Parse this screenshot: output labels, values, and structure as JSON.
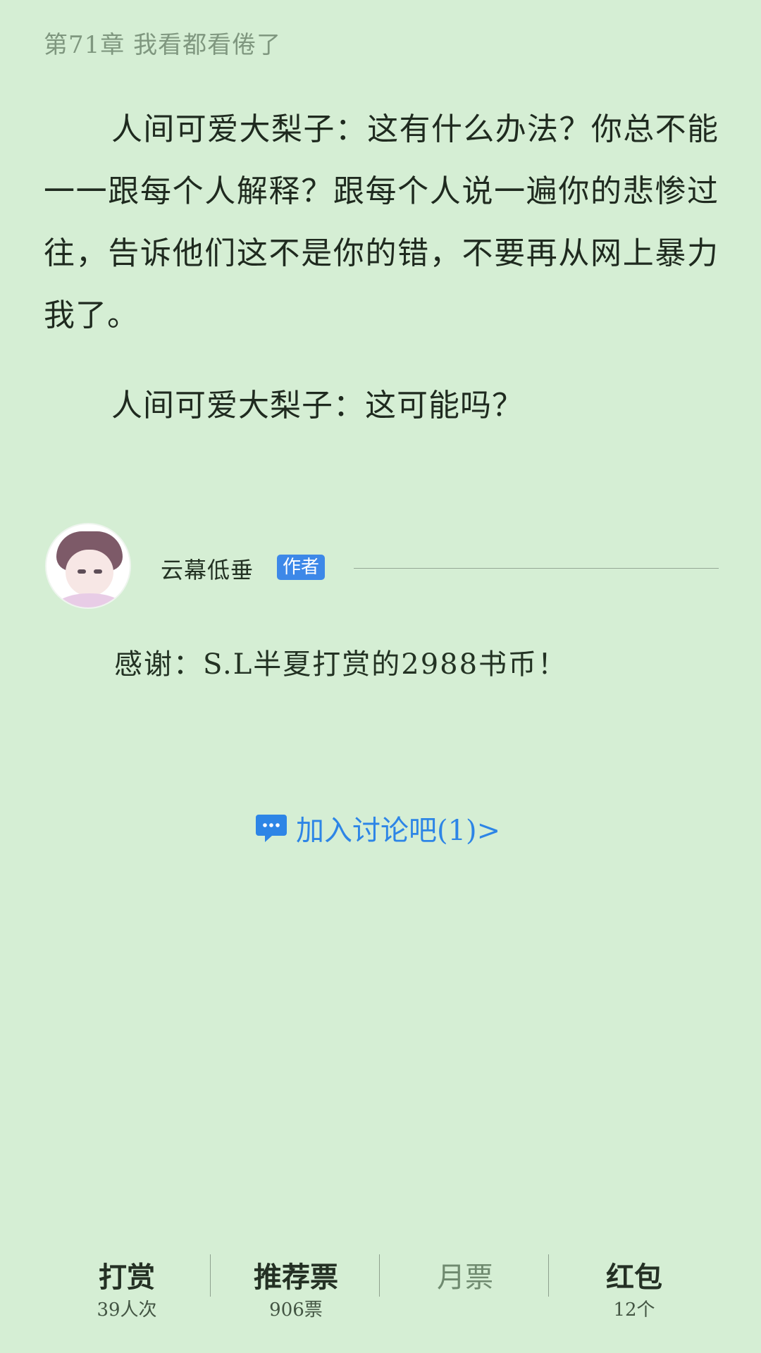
{
  "chapter": {
    "title": "第71章 我看都看倦了"
  },
  "content": {
    "paragraphs": [
      "人间可爱大梨子：这有什么办法？你总不能一一跟每个人解释？跟每个人说一遍你的悲惨过往，告诉他们这不是你的错，不要再从网上暴力我了。",
      "人间可爱大梨子：这可能吗？"
    ]
  },
  "author_note": {
    "author_name": "云幕低垂",
    "badge_label": "作者",
    "thanks_text": "感谢：S.L半夏打赏的2988书币！"
  },
  "discussion": {
    "label": "加入讨论吧(1)>",
    "icon": "chat-bubble-icon",
    "accent_color": "#2d85e6"
  },
  "bottom_bar": {
    "items": [
      {
        "label": "打赏",
        "count": "39人次"
      },
      {
        "label": "推荐票",
        "count": "906票"
      },
      {
        "label": "月票",
        "count": ""
      },
      {
        "label": "红包",
        "count": "12个"
      }
    ]
  }
}
